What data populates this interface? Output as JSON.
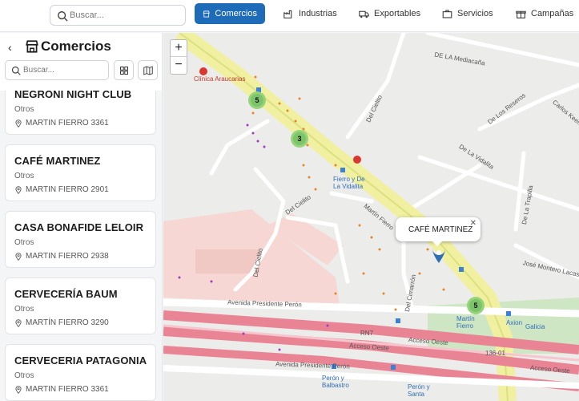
{
  "topbar": {
    "search_placeholder": "Buscar...",
    "tabs": [
      {
        "label": "Comercios",
        "icon": "store-icon",
        "active": true
      },
      {
        "label": "Industrias",
        "icon": "factory-icon",
        "active": false
      },
      {
        "label": "Exportables",
        "icon": "truck-icon",
        "active": false
      },
      {
        "label": "Servicios",
        "icon": "briefcase-icon",
        "active": false
      },
      {
        "label": "Campañas",
        "icon": "gift-icon",
        "active": false
      }
    ]
  },
  "sidebar": {
    "title": "Comercios",
    "search_placeholder": "Buscar...",
    "items": [
      {
        "name": "NEGRONI NIGHT CLUB",
        "category": "Otros",
        "address": "MARTIN FIERRO 3361"
      },
      {
        "name": "CAFÉ MARTINEZ",
        "category": "Otros",
        "address": "MARTIN FIERRO 2901"
      },
      {
        "name": "CASA BONAFIDE LELOIR",
        "category": "Otros",
        "address": "MARTIN FIERRO 2938"
      },
      {
        "name": "CERVECERÍA BAUM",
        "category": "Otros",
        "address": "MARTÍN FIERRO 3290"
      },
      {
        "name": "CERVECERIA PATAGONIA",
        "category": "Otros",
        "address": "MARTIN FIERRO 3361"
      }
    ]
  },
  "map": {
    "popup_label": "CAFÉ MARTINEZ",
    "zoom_in": "+",
    "zoom_out": "−",
    "clusters": [
      "5",
      "3",
      "5"
    ],
    "labels": {
      "clinica": "Clínica Araucarias",
      "mediacana": "DE LA Mediacaña",
      "reseros": "De Los Reseros",
      "carlos": "Carlos Keen",
      "vidalita": "De La Vidalita",
      "trapilla": "De La Trapilla",
      "cielito1": "Del Cielito",
      "cielito2": "Del Cielito",
      "cielito3": "Del Cielito",
      "martinfierro": "Martín Fierro",
      "fierro_vidalita": "Fierro y De La Vidalita",
      "jose": "José Montero Lacasa",
      "cimarron": "Del Cimarrón",
      "av1": "Avenida Presidente Perón",
      "av2": "Avenida Presidente Perón",
      "acceso1": "Acceso Oeste",
      "acceso2": "Acceso Oeste",
      "acceso3": "Acceso Oeste",
      "rn7": "RN7",
      "km136": "136-01",
      "axion": "Axion",
      "galicia": "Galicia",
      "martin_fierro_stop": "Martín Fierro",
      "peron_balbastro": "Perón y Balbastro",
      "peron_santa": "Perón y Santa"
    }
  }
}
